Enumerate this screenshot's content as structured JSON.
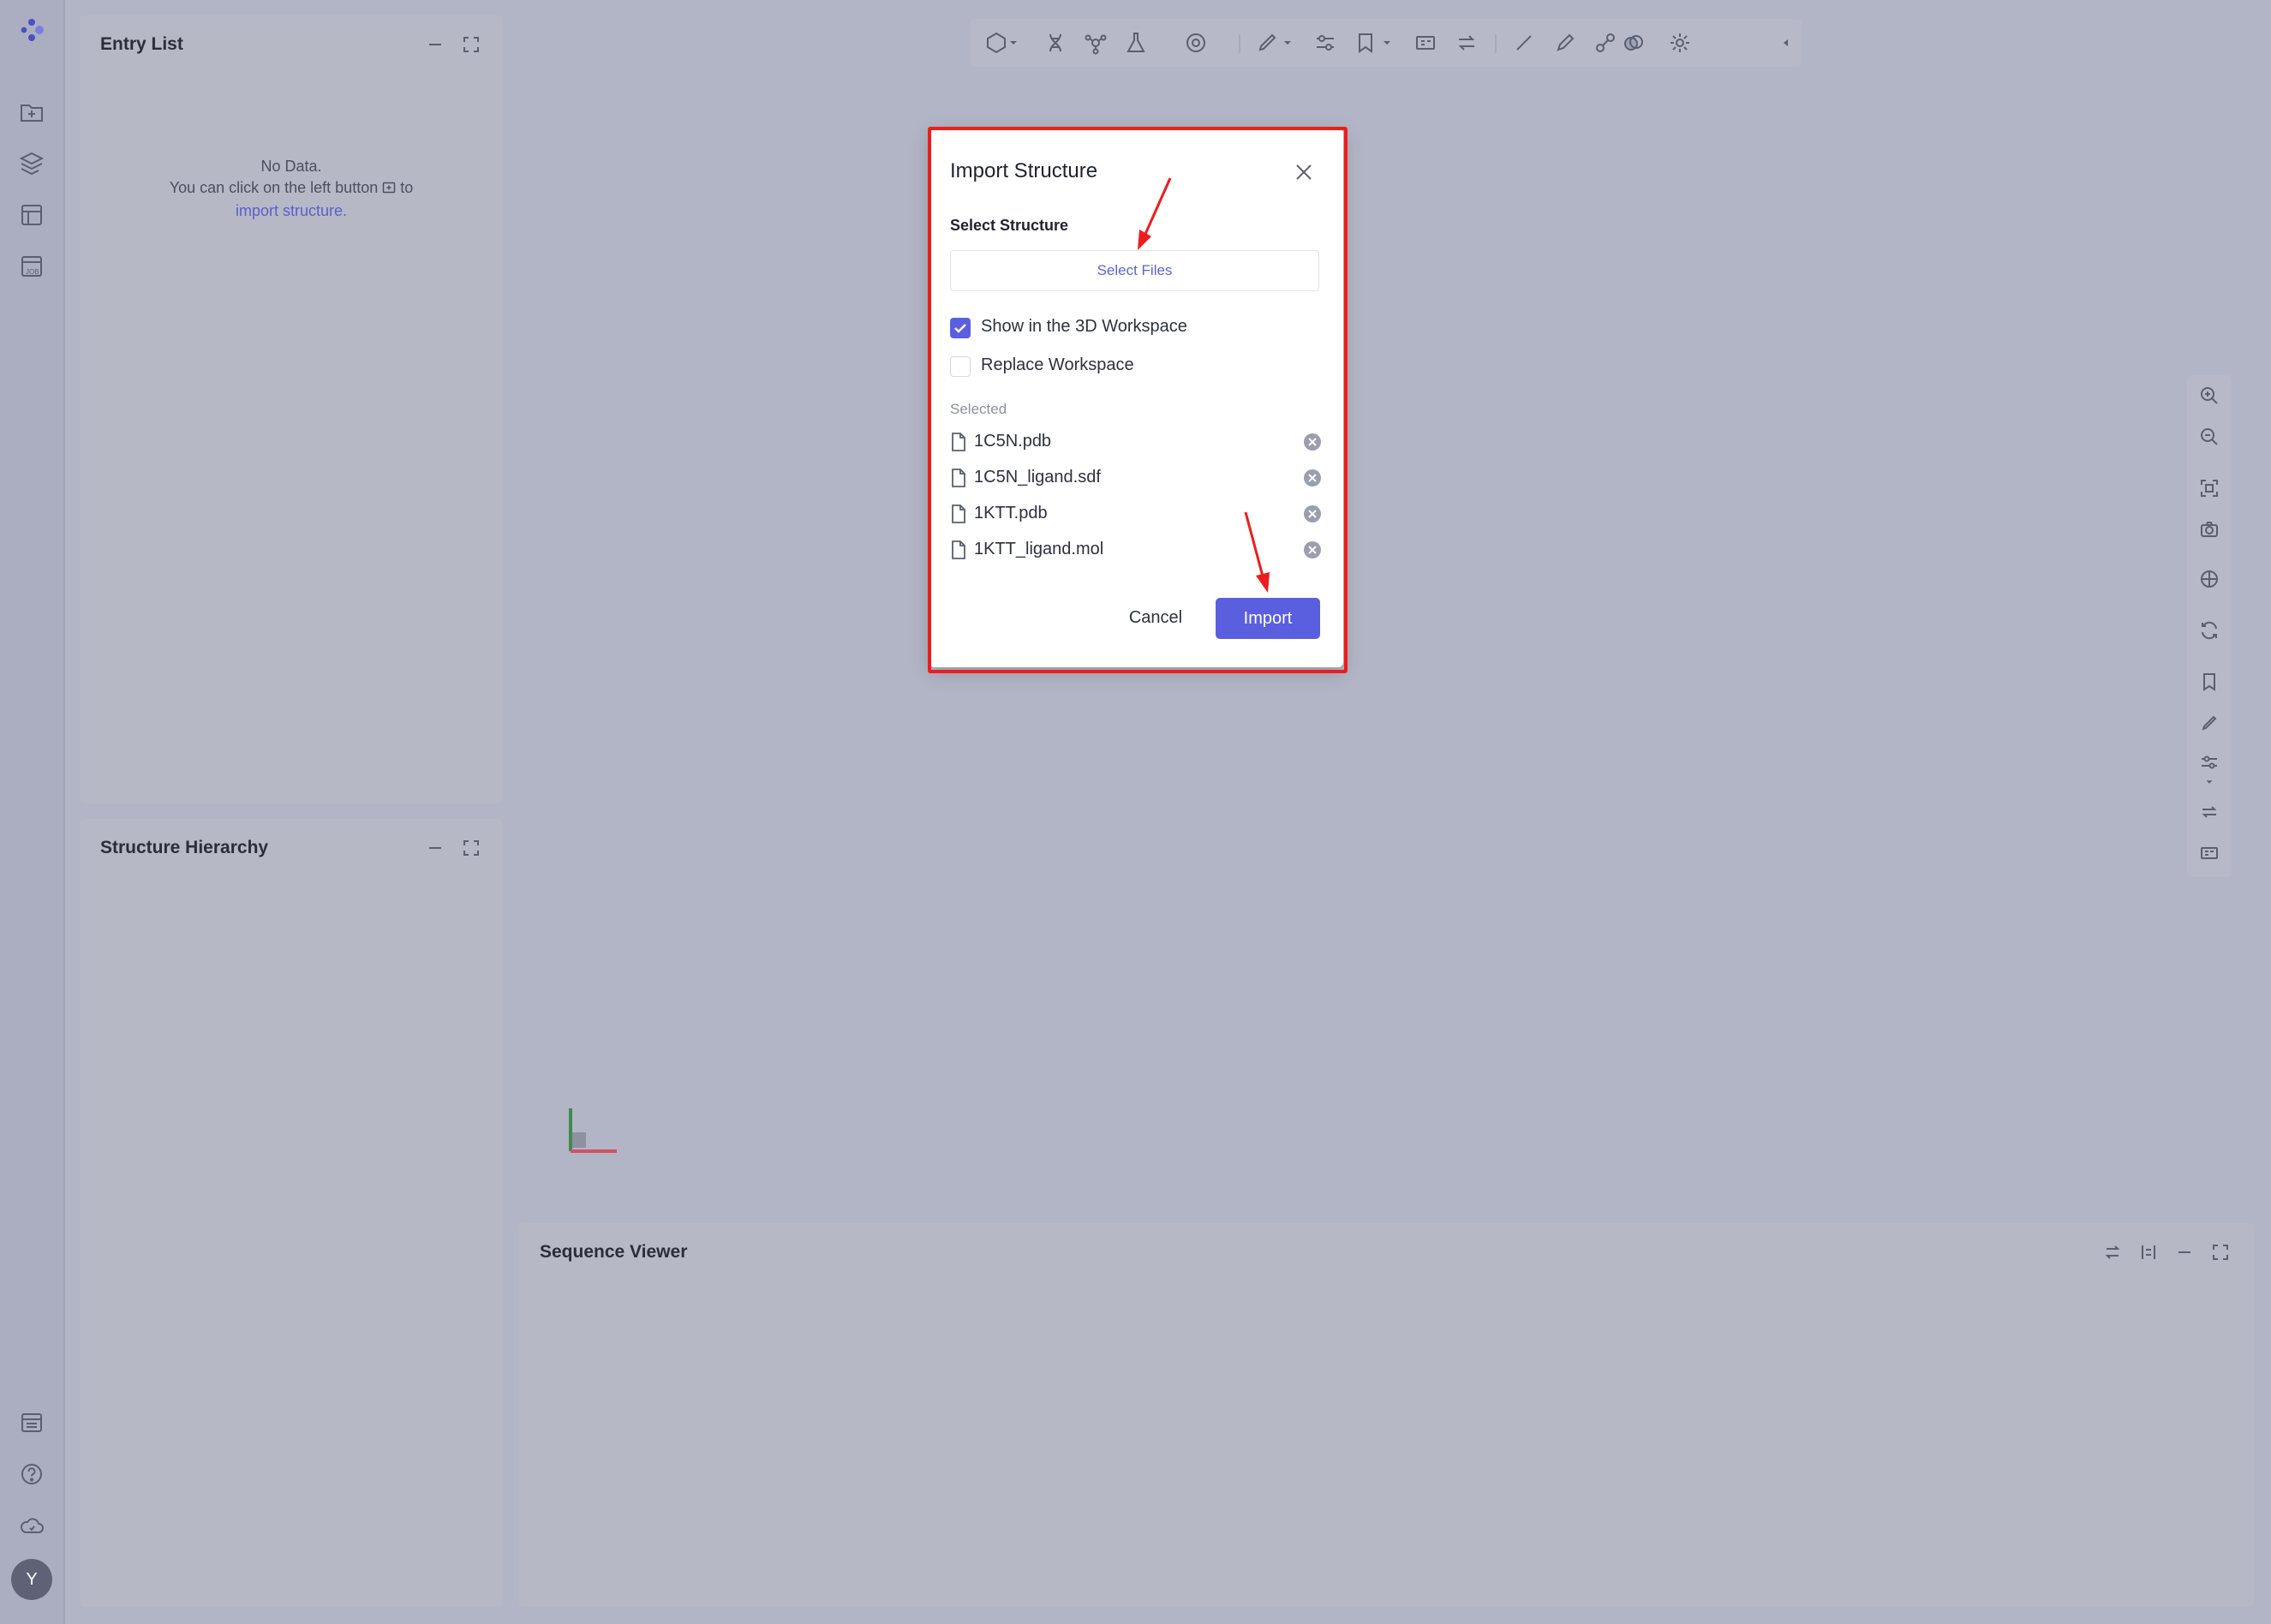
{
  "app": {
    "user_initial": "Y"
  },
  "entry_list": {
    "title": "Entry List",
    "empty_title": "No Data.",
    "empty_line1": "You can click on the left button",
    "empty_to": "to",
    "empty_link": "import structure."
  },
  "structure_hierarchy": {
    "title": "Structure Hierarchy"
  },
  "sequence_viewer": {
    "title": "Sequence Viewer"
  },
  "modal": {
    "title": "Import Structure",
    "section_label": "Select Structure",
    "select_files_label": "Select Files",
    "options": [
      {
        "label": "Show in the 3D Workspace",
        "checked": true
      },
      {
        "label": "Replace Workspace",
        "checked": false
      }
    ],
    "selected_label": "Selected",
    "files": [
      "1C5N.pdb",
      "1C5N_ligand.sdf",
      "1KTT.pdb",
      "1KTT_ligand.mol"
    ],
    "cancel_label": "Cancel",
    "import_label": "Import"
  },
  "colors": {
    "accent": "#5a5fe0",
    "highlight": "#ee1c1c",
    "overlay_bg": "#b2b5c5"
  },
  "icons": {
    "nav_top": [
      "app-logo-icon",
      "import-folder-icon",
      "layers-icon",
      "table-icon",
      "job-icon"
    ],
    "nav_bottom": [
      "list-icon",
      "help-icon",
      "cloud-icon"
    ],
    "toolbar": [
      "hexagon-icon",
      "dna-icon",
      "molecule-icon",
      "flask-icon",
      "target-icon",
      "paint-icon",
      "sliders-icon",
      "bookmark-icon",
      "grid-icon",
      "swap-icon",
      "line-icon",
      "pen-icon",
      "link-icon",
      "overlap-icon",
      "settings-icon",
      "collapse-icon"
    ],
    "right": [
      "zoom-in-icon",
      "zoom-out-icon",
      "fit-icon",
      "camera-icon",
      "crosshair-icon",
      "rotate-icon",
      "bookmark-icon",
      "paint-icon",
      "sliders-icon",
      "swap-icon",
      "grid-icon"
    ]
  }
}
